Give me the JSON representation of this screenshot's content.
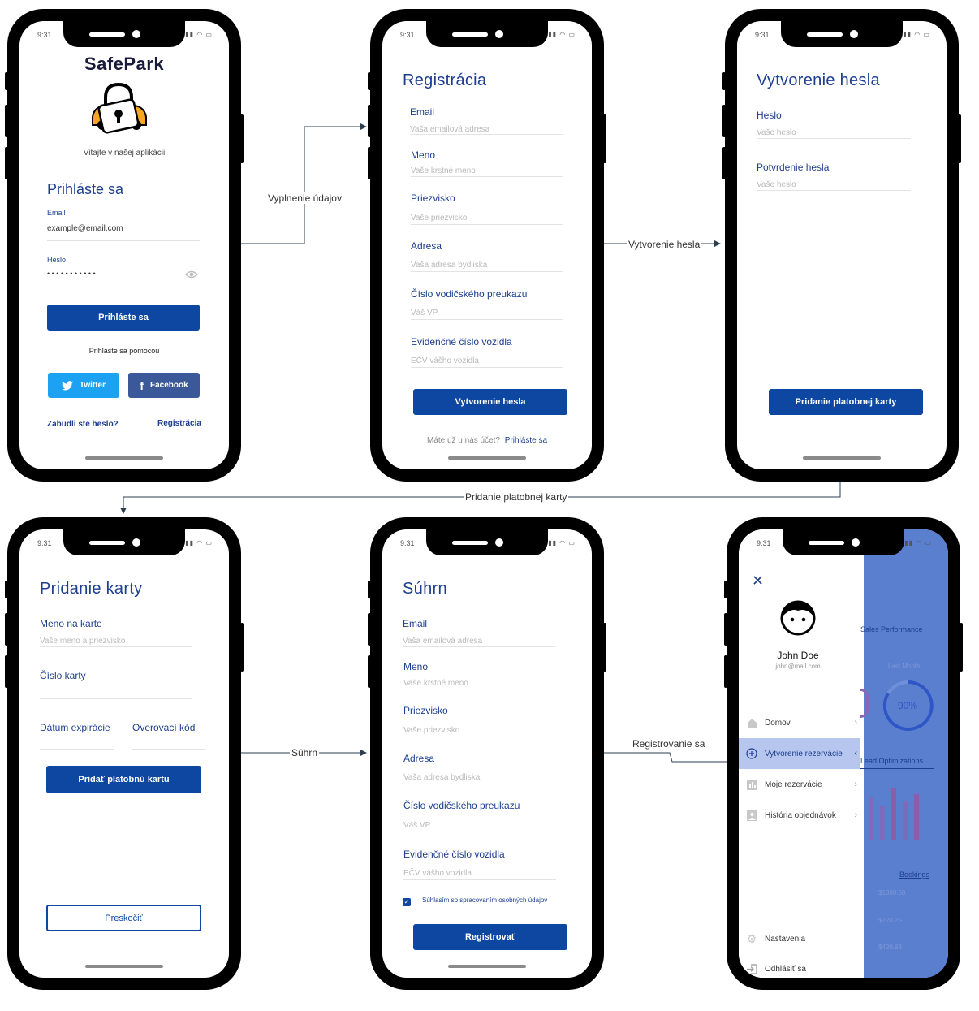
{
  "status": {
    "time": "9:31"
  },
  "connectors": {
    "c1": "Vyplnenie údajov",
    "c2": "Vytvorenie hesla",
    "c3": "Pridanie platobnej karty",
    "c4": "Súhrn",
    "c5": "Registrovanie sa"
  },
  "login": {
    "app_name": "SafePark",
    "welcome": "Vitajte v našej aplikácii",
    "title": "Prihláste sa",
    "email_label": "Email",
    "email_value": "example@email.com",
    "password_label": "Heslo",
    "password_value": "• • • • • • • • • • •",
    "login_button": "Prihláste sa",
    "social_text": "Prihláste sa pomocou",
    "twitter": "Twitter",
    "facebook": "Facebook",
    "forgot": "Zabudli ste heslo?",
    "register": "Registrácia",
    "colors": {
      "twitter": "#1da1f2",
      "facebook": "#3b5998"
    }
  },
  "registration": {
    "title": "Registrácia",
    "fields": [
      {
        "label": "Email",
        "placeholder": "Vaša emailová adresa"
      },
      {
        "label": "Meno",
        "placeholder": "Vaše krstné meno"
      },
      {
        "label": "Priezvisko",
        "placeholder": "Vaše priezvisko"
      },
      {
        "label": "Adresa",
        "placeholder": "Vaša adresa bydliska"
      },
      {
        "label": "Číslo vodičského preukazu",
        "placeholder": "Váš VP"
      },
      {
        "label": "Evidenčné číslo vozidla",
        "placeholder": "EČV vášho vozidla"
      }
    ],
    "button": "Vytvorenie hesla",
    "have_account": "Máte už u nás účet?",
    "login_link": "Prihláste sa"
  },
  "password": {
    "title": "Vytvorenie hesla",
    "fields": [
      {
        "label": "Heslo",
        "placeholder": "Vaše heslo"
      },
      {
        "label": "Potvrdenie hesla",
        "placeholder": "Vaše heslo"
      }
    ],
    "button": "Pridanie platobnej karty"
  },
  "card": {
    "title": "Pridanie karty",
    "name_label": "Meno na karte",
    "name_placeholder": "Vaše meno a priezvisko",
    "number_label": "Číslo karty",
    "expiry_label": "Dátum expirácie",
    "cvc_label": "Overovací kód",
    "button": "Pridať platobnú kartu",
    "skip": "Preskočiť"
  },
  "summary": {
    "title": "Súhrn",
    "fields": [
      {
        "label": "Email",
        "placeholder": "Vaša emailová adresa"
      },
      {
        "label": "Meno",
        "placeholder": "Vaše krstné meno"
      },
      {
        "label": "Priezvisko",
        "placeholder": "Vaše priezvisko"
      },
      {
        "label": "Adresa",
        "placeholder": "Vaša adresa bydliska"
      },
      {
        "label": "Číslo vodičského preukazu",
        "placeholder": "Váš VP"
      },
      {
        "label": "Evidenčné číslo vozidla",
        "placeholder": "EČV vášho vozidla"
      }
    ],
    "consent": "Súhlasím so spracovaním osobných údajov",
    "button": "Registrovať"
  },
  "menu": {
    "user_name": "John Doe",
    "user_email": "john@mail.com",
    "items": [
      {
        "label": "Domov",
        "icon": "home-icon"
      },
      {
        "label": "Vytvorenie rezervácie",
        "icon": "plus-circle-icon"
      },
      {
        "label": "Moje rezervácie",
        "icon": "chart-icon"
      },
      {
        "label": "História objednávok",
        "icon": "person-card-icon"
      }
    ],
    "settings": "Nastavenia",
    "logout": "Odhlásiť sa",
    "background": {
      "sales": "Sales Performance",
      "last_month": "Last Month",
      "percent": "90%",
      "lead": "Lead Optimizations",
      "bookings": "Bookings",
      "amounts": [
        "$1300.50",
        "$720.25",
        "$420.83"
      ]
    }
  }
}
